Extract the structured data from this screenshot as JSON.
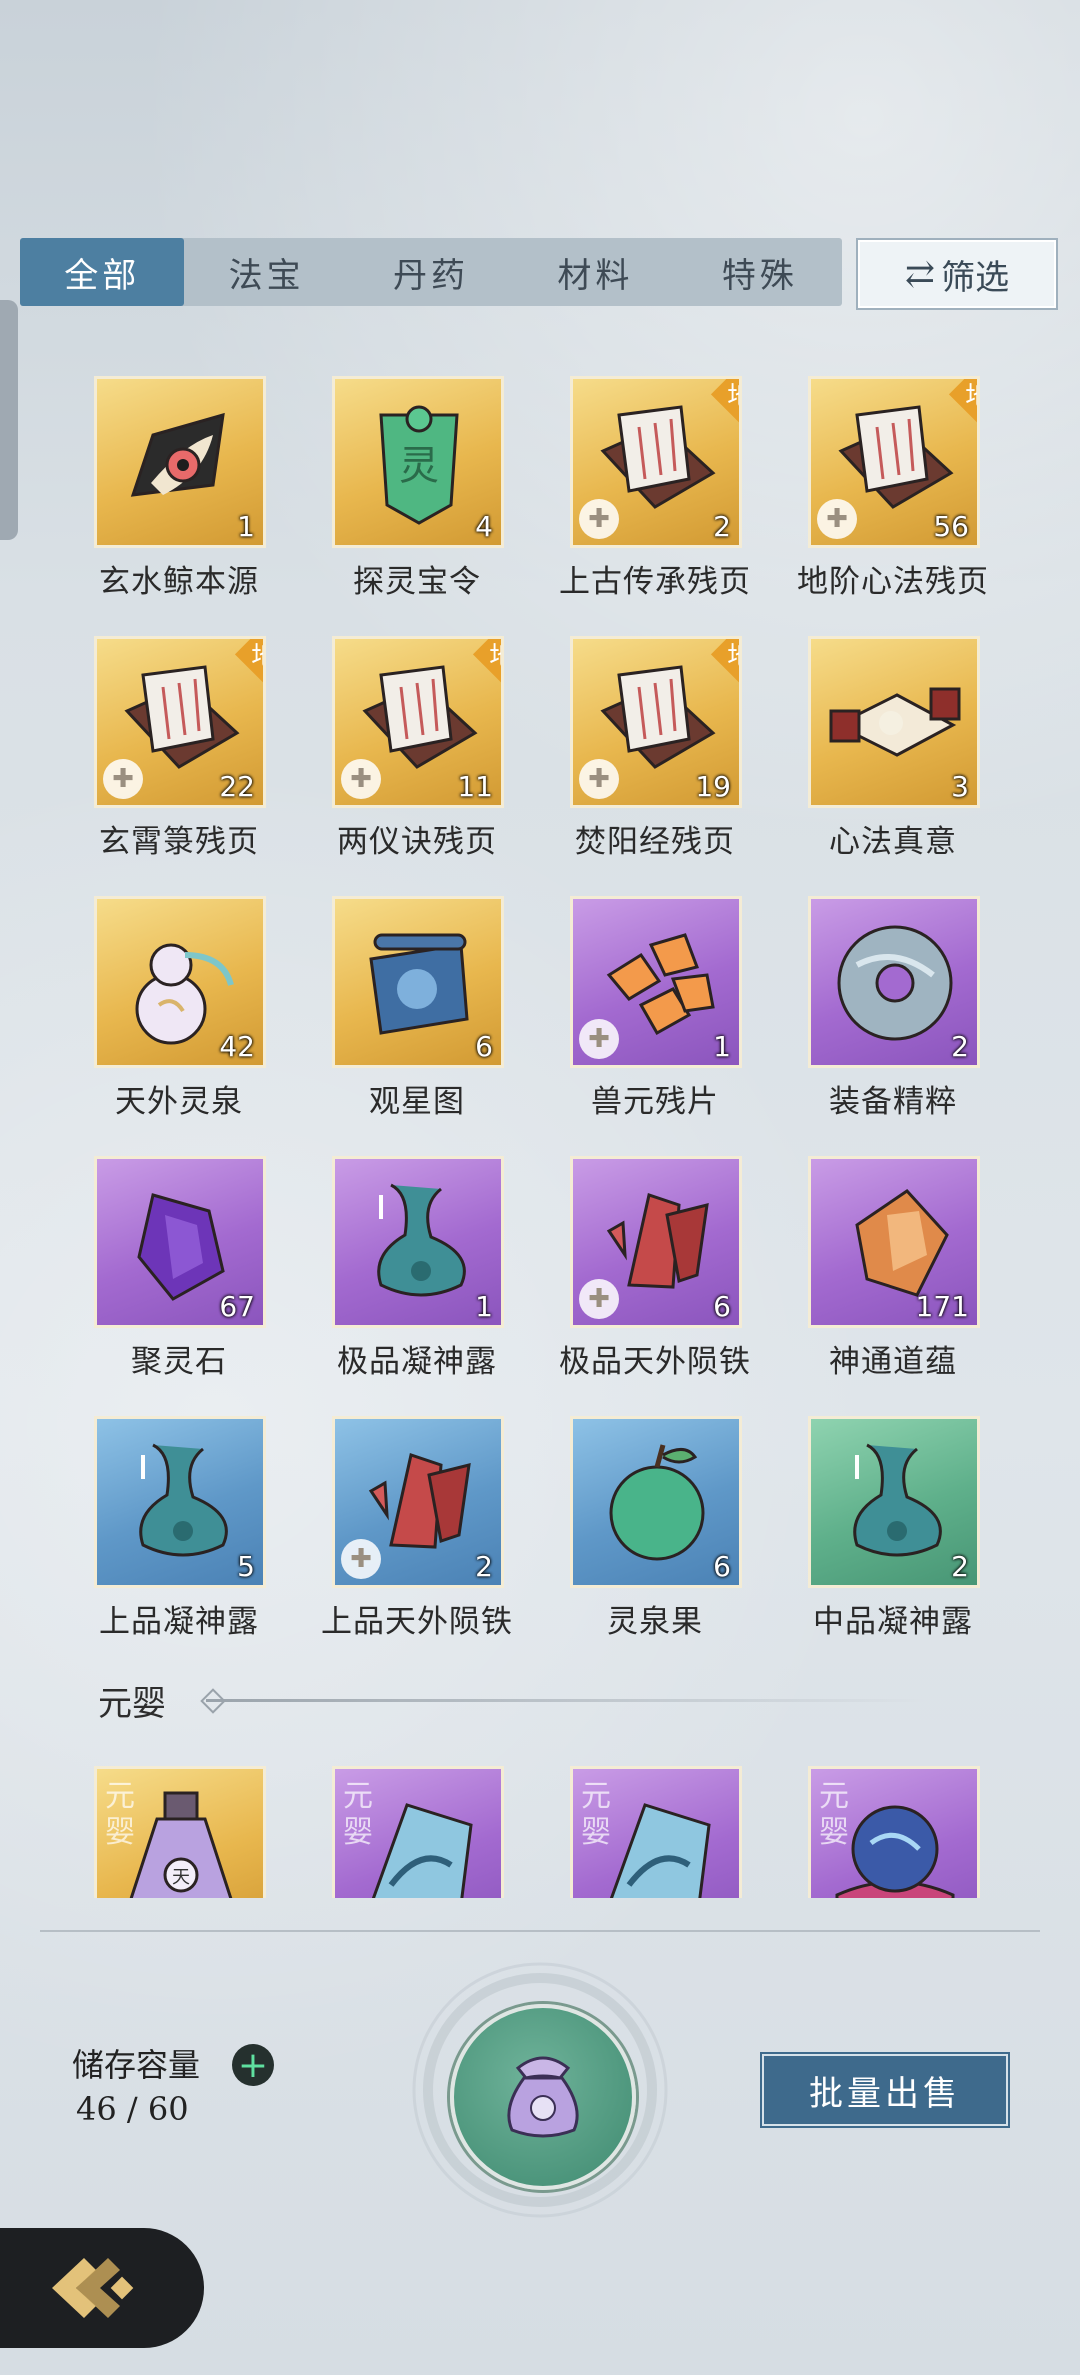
{
  "tabs": [
    {
      "label": "全部",
      "active": true
    },
    {
      "label": "法宝",
      "active": false
    },
    {
      "label": "丹药",
      "active": false
    },
    {
      "label": "材料",
      "active": false
    },
    {
      "label": "特殊",
      "active": false
    }
  ],
  "filter": {
    "label": "筛选",
    "icon": "swap-arrows-icon"
  },
  "items": [
    {
      "name": "玄水鲸本源",
      "count": "1",
      "rarity": "gold",
      "icon": "whale-eye-icon"
    },
    {
      "name": "探灵宝令",
      "count": "4",
      "rarity": "gold",
      "icon": "jade-token-icon"
    },
    {
      "name": "上古传承残页",
      "count": "2",
      "rarity": "gold",
      "icon": "scroll-box-icon",
      "grade": "地",
      "fragment": true
    },
    {
      "name": "地阶心法残页",
      "count": "56",
      "rarity": "gold",
      "icon": "scroll-box-icon",
      "grade": "地",
      "fragment": true
    },
    {
      "name": "玄霄箓残页",
      "count": "22",
      "rarity": "gold",
      "icon": "scroll-box-icon",
      "grade": "地",
      "fragment": true
    },
    {
      "name": "两仪诀残页",
      "count": "11",
      "rarity": "gold",
      "icon": "scroll-box-icon",
      "grade": "地",
      "fragment": true
    },
    {
      "name": "焚阳经残页",
      "count": "19",
      "rarity": "gold",
      "icon": "scroll-box-icon",
      "grade": "地",
      "fragment": true
    },
    {
      "name": "心法真意",
      "count": "3",
      "rarity": "gold",
      "icon": "open-scroll-icon"
    },
    {
      "name": "天外灵泉",
      "count": "42",
      "rarity": "gold",
      "icon": "gourd-icon"
    },
    {
      "name": "观星图",
      "count": "6",
      "rarity": "gold",
      "icon": "star-map-icon"
    },
    {
      "name": "兽元残片",
      "count": "1",
      "rarity": "purple",
      "icon": "beast-shards-icon",
      "fragment": true
    },
    {
      "name": "装备精粹",
      "count": "2",
      "rarity": "purple",
      "icon": "jade-ring-icon"
    },
    {
      "name": "聚灵石",
      "count": "67",
      "rarity": "purple",
      "icon": "spirit-crystal-icon"
    },
    {
      "name": "极品凝神露",
      "count": "1",
      "rarity": "purple",
      "icon": "dew-vase-icon"
    },
    {
      "name": "极品天外陨铁",
      "count": "6",
      "rarity": "purple",
      "icon": "meteor-iron-icon",
      "fragment": true
    },
    {
      "name": "神通道蕴",
      "count": "171",
      "rarity": "purple",
      "icon": "amber-crystal-icon"
    },
    {
      "name": "上品凝神露",
      "count": "5",
      "rarity": "blue",
      "icon": "dew-vase-icon"
    },
    {
      "name": "上品天外陨铁",
      "count": "2",
      "rarity": "blue",
      "icon": "meteor-iron-icon",
      "fragment": true
    },
    {
      "name": "灵泉果",
      "count": "6",
      "rarity": "blue",
      "icon": "spirit-fruit-icon"
    },
    {
      "name": "中品凝神露",
      "count": "2",
      "rarity": "green",
      "icon": "dew-vase-icon"
    }
  ],
  "section": {
    "title": "元婴"
  },
  "peek_items": [
    {
      "rarity": "gold",
      "tag": "元婴",
      "icon": "potion-bottle-icon"
    },
    {
      "rarity": "purple",
      "tag": "元婴",
      "icon": "dragon-shard-icon"
    },
    {
      "rarity": "purple",
      "tag": "元婴",
      "icon": "dragon-shard-icon"
    },
    {
      "rarity": "purple",
      "tag": "元婴",
      "icon": "crystal-orb-icon"
    }
  ],
  "storage": {
    "label": "储存容量",
    "value": "46 / 60"
  },
  "bag_button": {
    "icon": "pouch-icon"
  },
  "sell_button": {
    "label": "批量出售"
  },
  "back_button": {
    "icon": "back-arrow-icon"
  },
  "colors": {
    "tab_active": "#4d7fa1",
    "gold": "#e8b74e",
    "purple": "#a36ad0",
    "blue": "#5f98c8",
    "green": "#5fb08b",
    "sell_button": "#3e6a8c"
  }
}
